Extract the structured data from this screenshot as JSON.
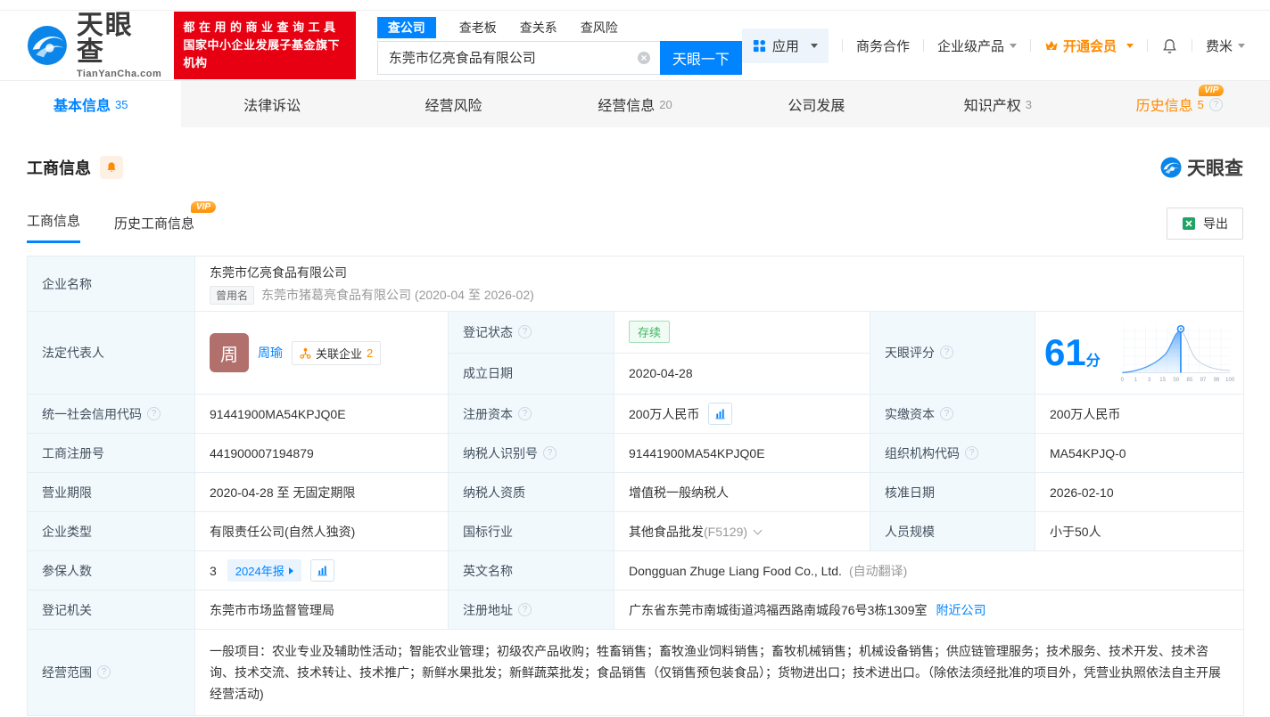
{
  "colors": {
    "accent_blue": "#0084ff",
    "brand_red": "#e60012",
    "vip_orange": "#ff8a00",
    "status_green": "#3eb761"
  },
  "header": {
    "logo_brand": "天眼查",
    "logo_domain": "TianYanCha.com",
    "slogan_line1": "都在用的商业查询工具",
    "slogan_line2": "国家中小企业发展子基金旗下机构",
    "search_tabs": [
      "查公司",
      "查老板",
      "查关系",
      "查风险"
    ],
    "search_value": "东莞市亿亮食品有限公司",
    "search_button": "天眼一下",
    "nav": {
      "apps": "应用",
      "biz": "商务合作",
      "enterprise": "企业级产品",
      "vip": "开通会员",
      "user": "费米"
    }
  },
  "nav_tabs": [
    {
      "label": "基本信息",
      "count": "35"
    },
    {
      "label": "法律诉讼"
    },
    {
      "label": "经营风险"
    },
    {
      "label": "经营信息",
      "count": "20"
    },
    {
      "label": "公司发展"
    },
    {
      "label": "知识产权",
      "count": "3"
    },
    {
      "label": "历史信息",
      "count": "5"
    }
  ],
  "section": {
    "title": "工商信息",
    "watermark": "天眼查",
    "subtabs": [
      "工商信息",
      "历史工商信息"
    ],
    "vip_label": "VIP",
    "export_label": "导出"
  },
  "info": {
    "company_name": {
      "label": "企业名称",
      "value": "东莞市亿亮食品有限公司",
      "former_badge": "曾用名",
      "former_value": "东莞市猪葛亮食品有限公司 (2020-04 至 2026-02)"
    },
    "legal_rep": {
      "label": "法定代表人",
      "avatar_char": "周",
      "name": "周瑜",
      "related_label": "关联企业",
      "related_count": "2"
    },
    "reg_status": {
      "label": "登记状态",
      "value": "存续"
    },
    "est_date": {
      "label": "成立日期",
      "value": "2020-04-28"
    },
    "score": {
      "label": "天眼评分",
      "value": "61",
      "unit": "分",
      "axis": [
        "0",
        "1",
        "3",
        "15",
        "50",
        "85",
        "97",
        "99",
        "100"
      ]
    },
    "credit_code": {
      "label": "统一社会信用代码",
      "value": "91441900MA54KPJQ0E"
    },
    "reg_capital": {
      "label": "注册资本",
      "value": "200万人民币"
    },
    "paid_capital": {
      "label": "实缴资本",
      "value": "200万人民币"
    },
    "reg_number": {
      "label": "工商注册号",
      "value": "441900007194879"
    },
    "taxpayer_id": {
      "label": "纳税人识别号",
      "value": "91441900MA54KPJQ0E"
    },
    "org_code": {
      "label": "组织机构代码",
      "value": "MA54KPJQ-0"
    },
    "biz_term": {
      "label": "营业期限",
      "value": "2020-04-28 至 无固定期限"
    },
    "taxpayer_quality": {
      "label": "纳税人资质",
      "value": "增值税一般纳税人"
    },
    "approval_date": {
      "label": "核准日期",
      "value": "2026-02-10"
    },
    "company_type": {
      "label": "企业类型",
      "value": "有限责任公司(自然人独资)"
    },
    "industry": {
      "label": "国标行业",
      "value": "其他食品批发",
      "code": "(F5129)"
    },
    "staff_size": {
      "label": "人员规模",
      "value": "小于50人"
    },
    "insured_count": {
      "label": "参保人数",
      "value": "3",
      "report_badge": "2024年报"
    },
    "english_name": {
      "label": "英文名称",
      "value": "Dongguan Zhuge Liang Food Co., Ltd.",
      "note": "(自动翻译)"
    },
    "reg_authority": {
      "label": "登记机关",
      "value": "东莞市市场监督管理局"
    },
    "address": {
      "label": "注册地址",
      "value": "广东省东莞市南城街道鸿福西路南城段76号3栋1309室",
      "nearby_link": "附近公司"
    },
    "biz_scope": {
      "label": "经营范围",
      "value": "一般项目：农业专业及辅助性活动；智能农业管理；初级农产品收购；牲畜销售；畜牧渔业饲料销售；畜牧机械销售；机械设备销售；供应链管理服务；技术服务、技术开发、技术咨询、技术交流、技术转让、技术推广；新鲜水果批发；新鲜蔬菜批发；食品销售（仅销售预包装食品）；货物进出口；技术进出口。（除依法须经批准的项目外，凭营业执照依法自主开展经营活动)"
    }
  }
}
